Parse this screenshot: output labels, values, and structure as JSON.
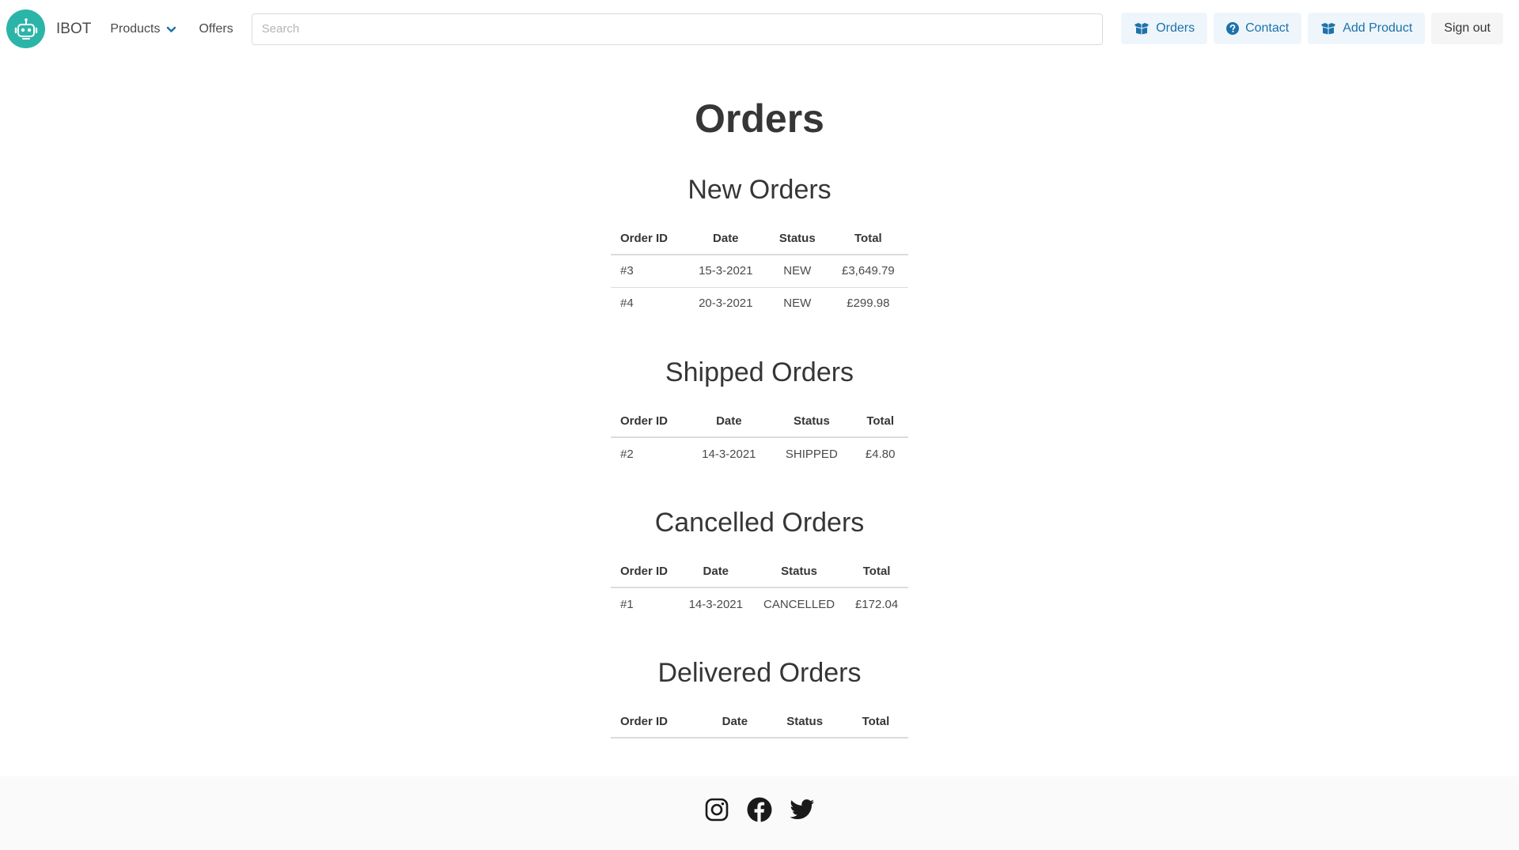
{
  "brand": {
    "name": "IBOT",
    "logo_icon": "robot-logo-icon",
    "logo_color": "#2bb5a8"
  },
  "nav": {
    "products_label": "Products",
    "offers_label": "Offers"
  },
  "search": {
    "placeholder": "Search",
    "value": ""
  },
  "actions": {
    "orders_label": "Orders",
    "contact_label": "Contact",
    "add_product_label": "Add Product",
    "sign_out_label": "Sign out"
  },
  "colors": {
    "accent_text": "#1d72aa",
    "accent_bg": "#eef6fc"
  },
  "page": {
    "title": "Orders"
  },
  "table_headers": {
    "order_id": "Order ID",
    "date": "Date",
    "status": "Status",
    "total": "Total"
  },
  "sections": {
    "new": {
      "title": "New Orders",
      "rows": [
        {
          "id": "#3",
          "date": "15-3-2021",
          "status": "NEW",
          "total": "£3,649.79"
        },
        {
          "id": "#4",
          "date": "20-3-2021",
          "status": "NEW",
          "total": "£299.98"
        }
      ]
    },
    "shipped": {
      "title": "Shipped Orders",
      "rows": [
        {
          "id": "#2",
          "date": "14-3-2021",
          "status": "SHIPPED",
          "total": "£4.80"
        }
      ]
    },
    "cancelled": {
      "title": "Cancelled Orders",
      "rows": [
        {
          "id": "#1",
          "date": "14-3-2021",
          "status": "CANCELLED",
          "total": "£172.04"
        }
      ]
    },
    "delivered": {
      "title": "Delivered Orders",
      "rows": []
    }
  },
  "footer": {
    "icons": [
      "instagram-icon",
      "facebook-icon",
      "twitter-icon"
    ]
  }
}
